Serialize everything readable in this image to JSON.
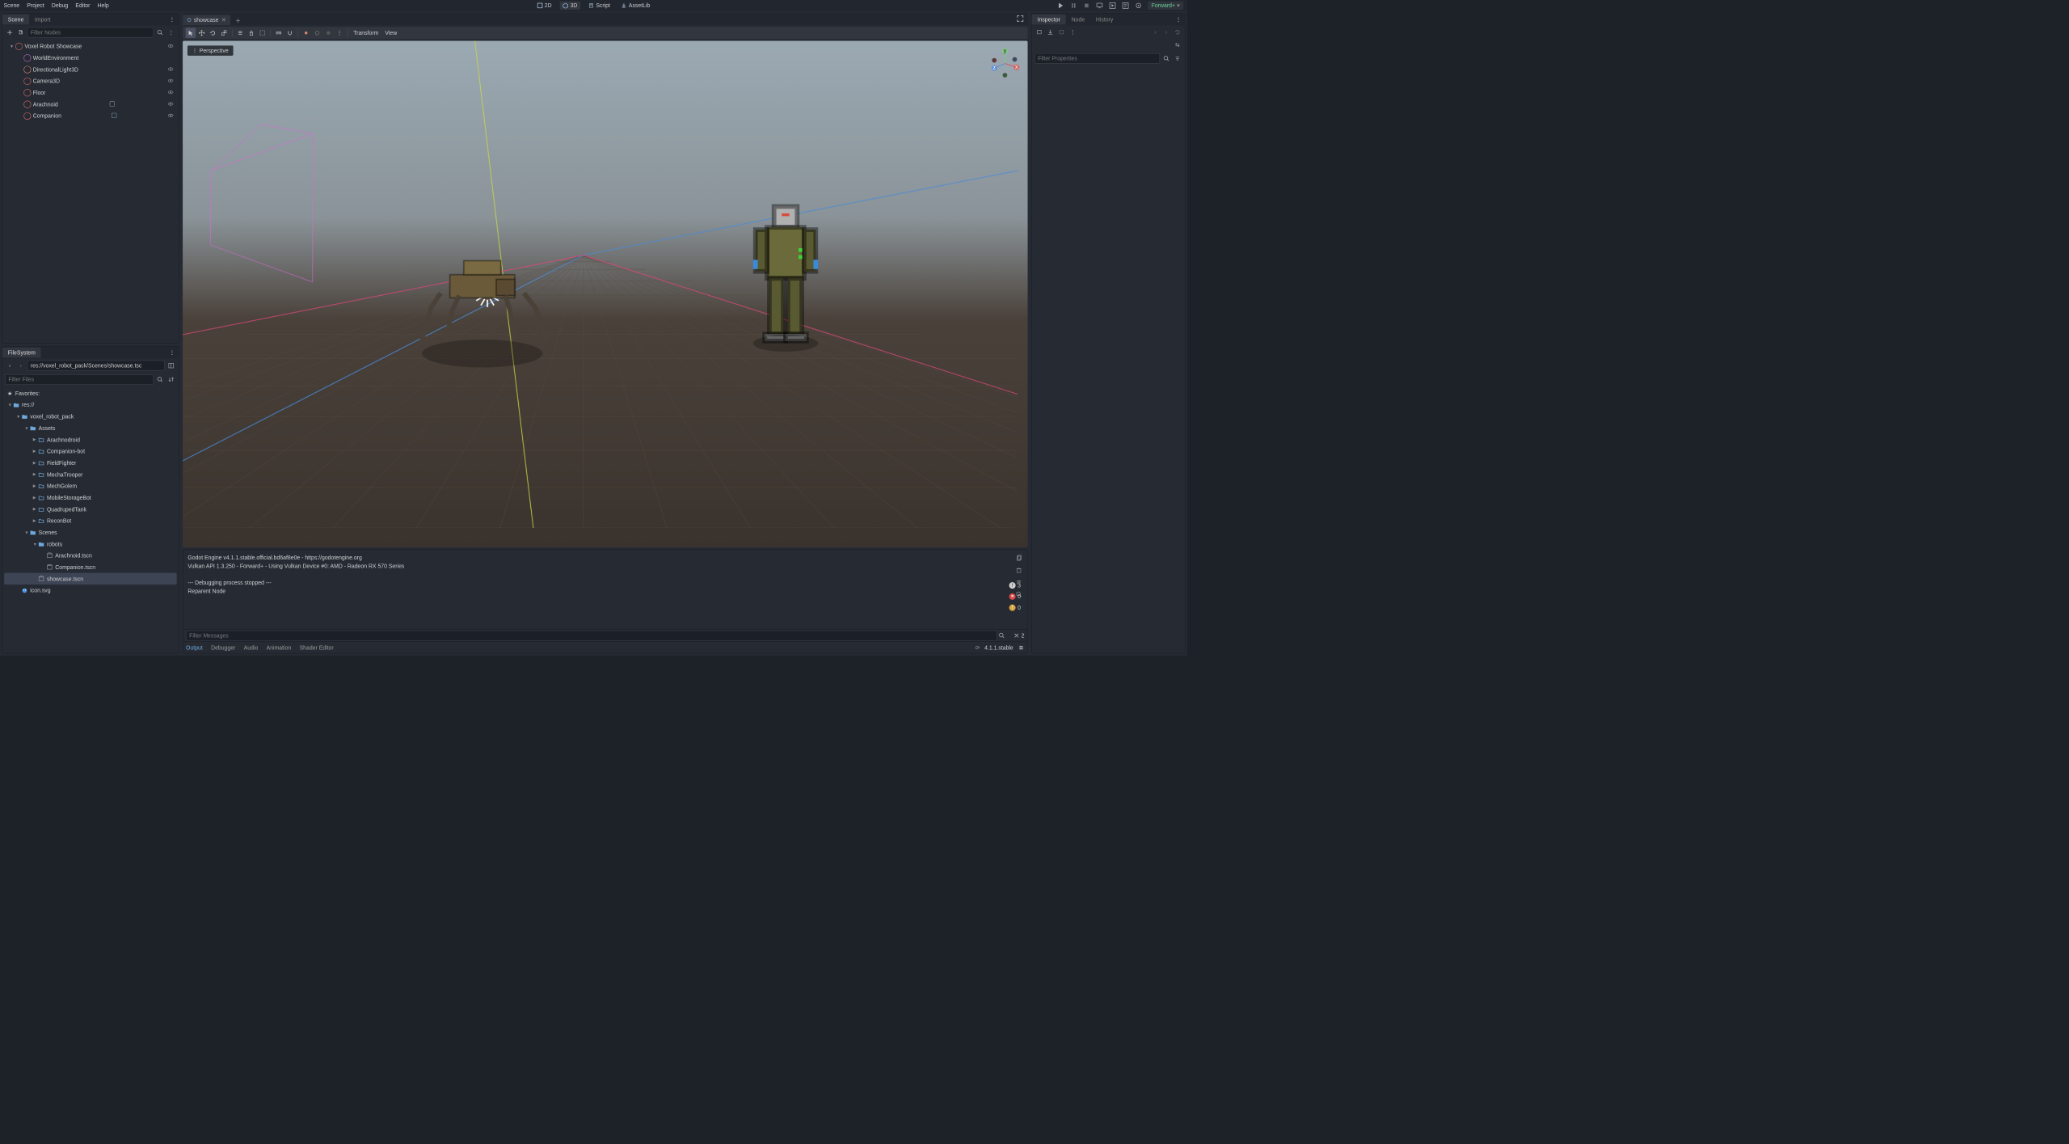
{
  "menu": {
    "items": [
      "Scene",
      "Project",
      "Debug",
      "Editor",
      "Help"
    ]
  },
  "mode_tabs": {
    "m2d": "2D",
    "m3d": "3D",
    "script": "Script",
    "assetlib": "AssetLib"
  },
  "renderer": "Forward+",
  "left": {
    "scene_tab": "Scene",
    "import_tab": "Import",
    "filter_nodes_ph": "Filter Nodes",
    "tree": [
      {
        "name": "Voxel Robot Showcase",
        "icon": "node3d",
        "depth": 0,
        "vis": true,
        "chev": "down",
        "color": "#e06a6a"
      },
      {
        "name": "WorldEnvironment",
        "icon": "env",
        "depth": 1,
        "vis": false,
        "color": "#c86ad0"
      },
      {
        "name": "DirectionalLight3D",
        "icon": "light",
        "depth": 1,
        "vis": true,
        "color": "#e0856a"
      },
      {
        "name": "Camera3D",
        "icon": "camera",
        "depth": 1,
        "vis": true,
        "color": "#e06a6a"
      },
      {
        "name": "Floor",
        "icon": "mesh",
        "depth": 1,
        "vis": true,
        "color": "#e06a6a"
      },
      {
        "name": "Arachnoid",
        "icon": "node3d",
        "depth": 1,
        "vis": true,
        "script": true,
        "color": "#e06a6a"
      },
      {
        "name": "Companion",
        "icon": "node3d",
        "depth": 1,
        "vis": true,
        "script": true,
        "color": "#e06a6a"
      }
    ]
  },
  "filesystem": {
    "tab": "FileSystem",
    "path": "res://voxel_robot_pack/Scenes/showcase.tsc",
    "filter_ph": "Filter Files",
    "favorites": "Favorites:",
    "tree": [
      {
        "label": "res://",
        "type": "folder",
        "depth": 0,
        "chev": "down",
        "open": true
      },
      {
        "label": "voxel_robot_pack",
        "type": "folder",
        "depth": 1,
        "chev": "down",
        "open": true
      },
      {
        "label": "Assets",
        "type": "folder",
        "depth": 2,
        "chev": "down",
        "open": true
      },
      {
        "label": "Arachnodroid",
        "type": "folder",
        "depth": 3,
        "chev": "right"
      },
      {
        "label": "Companion-bot",
        "type": "folder",
        "depth": 3,
        "chev": "right"
      },
      {
        "label": "FieldFighter",
        "type": "folder",
        "depth": 3,
        "chev": "right"
      },
      {
        "label": "MechaTrooper",
        "type": "folder",
        "depth": 3,
        "chev": "right"
      },
      {
        "label": "MechGolem",
        "type": "folder",
        "depth": 3,
        "chev": "right"
      },
      {
        "label": "MobileStorageBot",
        "type": "folder",
        "depth": 3,
        "chev": "right"
      },
      {
        "label": "QuadrupedTank",
        "type": "folder",
        "depth": 3,
        "chev": "right"
      },
      {
        "label": "ReconBot",
        "type": "folder",
        "depth": 3,
        "chev": "right"
      },
      {
        "label": "Scenes",
        "type": "folder",
        "depth": 2,
        "chev": "down",
        "open": true
      },
      {
        "label": "robots",
        "type": "folder",
        "depth": 3,
        "chev": "down",
        "open": true
      },
      {
        "label": "Arachnoid.tscn",
        "type": "scene",
        "depth": 4
      },
      {
        "label": "Companion.tscn",
        "type": "scene",
        "depth": 4
      },
      {
        "label": "showcase.tscn",
        "type": "scene",
        "depth": 3,
        "selected": true
      },
      {
        "label": "icon.svg",
        "type": "image",
        "depth": 1
      }
    ]
  },
  "viewport": {
    "open_tab": "showcase",
    "perspective": "Perspective",
    "transform_menu": "Transform",
    "view_menu": "View"
  },
  "output": {
    "lines": [
      "Godot Engine v4.1.1.stable.official.bd6af8e0e - https://godotengine.org",
      "Vulkan API 1.3.250 - Forward+ - Using Vulkan Device #0: AMD - Radeon RX 570 Series",
      "",
      "--- Debugging process stopped ---",
      "Reparent Node"
    ],
    "filter_ph": "Filter Messages",
    "count_info": "3",
    "count_err": "0",
    "count_warn": "0",
    "count_debug": "2",
    "tabs": [
      "Output",
      "Debugger",
      "Audio",
      "Animation",
      "Shader Editor"
    ],
    "version": "4.1.1.stable"
  },
  "inspector": {
    "tabs": {
      "inspector": "Inspector",
      "node": "Node",
      "history": "History"
    },
    "filter_ph": "Filter Properties"
  }
}
